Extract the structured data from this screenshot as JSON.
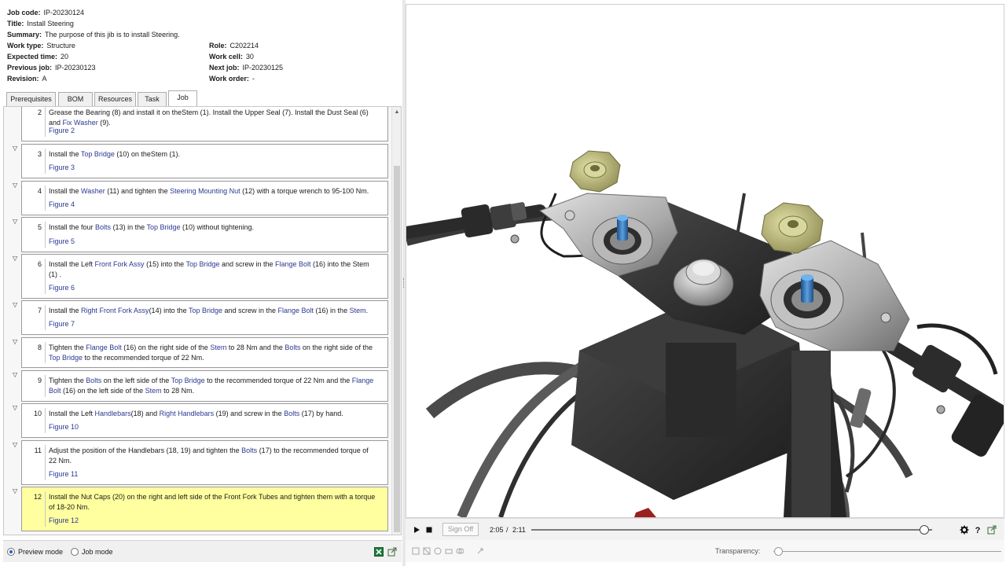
{
  "header": {
    "job_code": {
      "label": "Job code:",
      "value": "IP-20230124"
    },
    "title": {
      "label": "Title:",
      "value": "Install Steering"
    },
    "summary": {
      "label": "Summary:",
      "value": "The purpose of this jib is to install Steering."
    },
    "work_type": {
      "label": "Work type:",
      "value": "Structure"
    },
    "expected_time": {
      "label": "Expected time:",
      "value": "20"
    },
    "previous_job": {
      "label": "Previous job:",
      "value": "IP-20230123"
    },
    "revision": {
      "label": "Revision:",
      "value": "A"
    },
    "role": {
      "label": "Role:",
      "value": "C202214"
    },
    "work_cell": {
      "label": "Work cell:",
      "value": "30"
    },
    "next_job": {
      "label": "Next job:",
      "value": "IP-20230125"
    },
    "work_order": {
      "label": "Work order:",
      "value": "-"
    }
  },
  "tabs": [
    {
      "label": "Prerequisites",
      "active": false
    },
    {
      "label": "BOM",
      "active": false
    },
    {
      "label": "Resources",
      "active": false
    },
    {
      "label": "Task",
      "active": false
    },
    {
      "label": "Job",
      "active": true
    }
  ],
  "steps": [
    {
      "number": "2",
      "segments": [
        {
          "t": "Grease the Bearing (8) and install it on theStem (1). Install the Upper Seal (7). Install the Dust Seal (6) and "
        },
        {
          "t": "Fix Washer",
          "link": true
        },
        {
          "t": " (9)."
        }
      ],
      "figure": "Figure 2",
      "highlight": false
    },
    {
      "number": "3",
      "segments": [
        {
          "t": "Install the "
        },
        {
          "t": "Top Bridge",
          "link": true
        },
        {
          "t": " (10) on theStem (1)."
        }
      ],
      "figure": "Figure 3",
      "highlight": false
    },
    {
      "number": "4",
      "segments": [
        {
          "t": "Install the "
        },
        {
          "t": "Washer",
          "link": true
        },
        {
          "t": " (11) and tighten the "
        },
        {
          "t": "Steering Mounting Nut",
          "link": true
        },
        {
          "t": " (12) with a torque wrench to 95-100 Nm."
        }
      ],
      "figure": "Figure 4",
      "highlight": false
    },
    {
      "number": "5",
      "segments": [
        {
          "t": "Install the four "
        },
        {
          "t": "Bolts",
          "link": true
        },
        {
          "t": " (13) in the "
        },
        {
          "t": "Top Bridge",
          "link": true
        },
        {
          "t": " (10) without tightening."
        }
      ],
      "figure": "Figure 5",
      "highlight": false
    },
    {
      "number": "6",
      "segments": [
        {
          "t": "Install the Left "
        },
        {
          "t": "Front Fork Assy",
          "link": true
        },
        {
          "t": " (15) into the "
        },
        {
          "t": "Top Bridge",
          "link": true
        },
        {
          "t": " and screw in the "
        },
        {
          "t": "Flange Bolt",
          "link": true
        },
        {
          "t": " (16) into the Stem (1) ."
        }
      ],
      "figure": "Figure 6",
      "highlight": false
    },
    {
      "number": "7",
      "segments": [
        {
          "t": "Install the "
        },
        {
          "t": "Right Front Fork Assy",
          "link": true
        },
        {
          "t": "(14) into the "
        },
        {
          "t": "Top Bridge",
          "link": true
        },
        {
          "t": " and screw in the "
        },
        {
          "t": "Flange Bolt",
          "link": true
        },
        {
          "t": " (16) in the "
        },
        {
          "t": "Stem",
          "link": true
        },
        {
          "t": "."
        }
      ],
      "figure": "Figure 7",
      "highlight": false
    },
    {
      "number": "8",
      "segments": [
        {
          "t": "Tighten the "
        },
        {
          "t": "Flange Bolt",
          "link": true
        },
        {
          "t": " (16) on the right side of the "
        },
        {
          "t": "Stem",
          "link": true
        },
        {
          "t": " to 28 Nm and the "
        },
        {
          "t": "Bolts",
          "link": true
        },
        {
          "t": " on the right side of the "
        },
        {
          "t": "Top Bridge",
          "link": true
        },
        {
          "t": " to the recommended torque of 22 Nm."
        }
      ],
      "figure": "",
      "highlight": false
    },
    {
      "number": "9",
      "segments": [
        {
          "t": "Tighten the "
        },
        {
          "t": "Bolts",
          "link": true
        },
        {
          "t": " on the left side of the "
        },
        {
          "t": "Top Bridge",
          "link": true
        },
        {
          "t": " to the recommended torque of 22 Nm and the "
        },
        {
          "t": "Flange Bolt",
          "link": true
        },
        {
          "t": " (16) on the left side of the "
        },
        {
          "t": "Stem",
          "link": true
        },
        {
          "t": " to 28 Nm."
        }
      ],
      "figure": "",
      "highlight": false
    },
    {
      "number": "10",
      "segments": [
        {
          "t": "Install the Left "
        },
        {
          "t": "Handlebars",
          "link": true
        },
        {
          "t": "(18) and "
        },
        {
          "t": "Right Handlebars",
          "link": true
        },
        {
          "t": " (19) and screw in the "
        },
        {
          "t": "Bolts",
          "link": true
        },
        {
          "t": " (17) by hand."
        }
      ],
      "figure": "Figure 10",
      "highlight": false
    },
    {
      "number": "11",
      "segments": [
        {
          "t": "Adjust the position of the Handlebars (18, 19) and tighten the "
        },
        {
          "t": "Bolts",
          "link": true
        },
        {
          "t": " (17) to the recommended torque of 22 Nm."
        }
      ],
      "figure": "Figure 11",
      "highlight": false
    },
    {
      "number": "12",
      "segments": [
        {
          "t": "Install the Nut Caps (20) on the right and left side of the Front Fork Tubes and tighten them with a torque of 18-20 Nm."
        }
      ],
      "figure": "Figure 12",
      "highlight": true
    }
  ],
  "bottom": {
    "preview_mode_label": "Preview mode",
    "job_mode_label": "Job mode",
    "selected_mode": "preview"
  },
  "player": {
    "signoff_label": "Sign Off",
    "current_time": "2:05",
    "separator": "/",
    "total_time": "2:11",
    "progress_fraction": 0.98
  },
  "transparency": {
    "label": "Transparency:",
    "value_fraction": 0.0
  },
  "colors": {
    "link": "#2b3990",
    "highlight": "#ffffa0",
    "bridge_gray": "#bdbdbd",
    "nut_gold": "#bdbb7a",
    "bolt_blue": "#3a78b8"
  }
}
